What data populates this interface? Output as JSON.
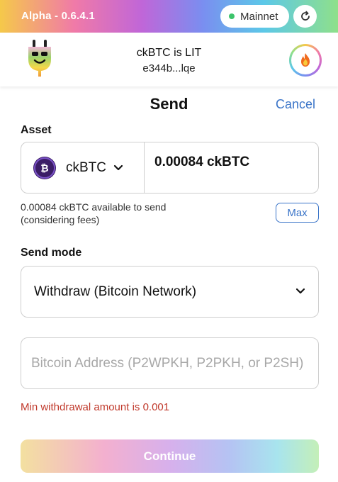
{
  "topbar": {
    "version": "Alpha - 0.6.4.1",
    "network_label": "Mainnet",
    "network_status_color": "#3cc46b"
  },
  "header": {
    "account_name": "ckBTC is LIT",
    "account_id": "e344b...lqe",
    "logo_icon": "plug-logo-icon",
    "avatar_icon": "fire-emoji-icon"
  },
  "send": {
    "title": "Send",
    "cancel_label": "Cancel",
    "asset_label": "Asset",
    "asset": {
      "name": "ckBTC",
      "icon": "bitcoin-icon",
      "amount": "0.00084 ckBTC"
    },
    "available_line1": "0.00084 ckBTC available to send",
    "available_line2": "(considering fees)",
    "max_label": "Max",
    "send_mode_label": "Send mode",
    "send_mode_value": "Withdraw (Bitcoin Network)",
    "address_placeholder": "Bitcoin Address (P2WPKH, P2PKH, or P2SH)",
    "address_value": "",
    "error_message": "Min withdrawal amount is 0.001",
    "continue_label": "Continue"
  },
  "colors": {
    "accent": "#3a74c8",
    "error": "#c0392b",
    "ckbtc_brand": "#3b1d66"
  }
}
